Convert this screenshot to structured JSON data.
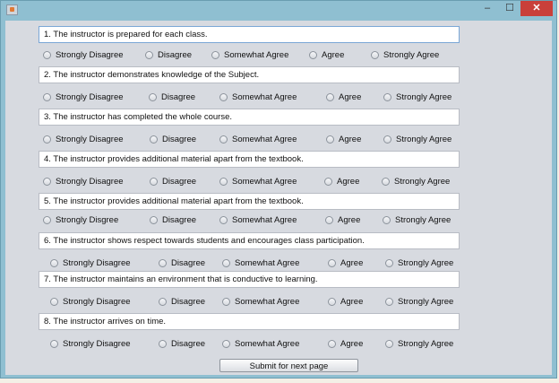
{
  "window": {
    "minimize": "–",
    "maximize": "☐",
    "close": "✕"
  },
  "questions": [
    {
      "text": "1. The instructor is prepared for each class.",
      "options": [
        "Strongly Disagree",
        "Disagree",
        "Somewhat Agree",
        "Agree",
        "Strongly Agree"
      ]
    },
    {
      "text": "2. The instructor demonstrates knowledge of the Subject.",
      "options": [
        "Strongly Disagree",
        "Disagree",
        "Somewhat Agree",
        "Agree",
        "Strongly Agree"
      ]
    },
    {
      "text": "3. The instructor has completed the whole course.",
      "options": [
        "Strongly Disagree",
        "Disagree",
        "Somewhat Agree",
        "Agree",
        "Strongly Agree"
      ]
    },
    {
      "text": "4. The instructor provides additional material apart from the textbook.",
      "options": [
        "Strongly Disagree",
        "Disagree",
        "Somewhat Agree",
        "Agree",
        "Strongly Agree"
      ]
    },
    {
      "text": "5. The instructor provides additional material apart from the textbook.",
      "options": [
        "Strongly Disgree",
        "Disagree",
        "Somewhat Agree",
        "Agree",
        "Strongly Agree"
      ]
    },
    {
      "text": "6. The instructor shows respect towards students and encourages class participation.",
      "options": [
        "Strongly Disagree",
        "Disagree",
        "Somewhat Agree",
        "Agree",
        "Strongly Agree"
      ]
    },
    {
      "text": "7. The instructor maintains an environment that is conductive to learning.",
      "options": [
        "Strongly Disagree",
        "Disagree",
        "Somewhat Agree",
        "Agree",
        "Strongly Agree"
      ]
    },
    {
      "text": "8. The instructor arrives on time.",
      "options": [
        "Strongly Disagree",
        "Disagree",
        "Somewhat Agree",
        "Agree",
        "Strongly Agree"
      ]
    }
  ],
  "submit_label": "Submit for next page"
}
